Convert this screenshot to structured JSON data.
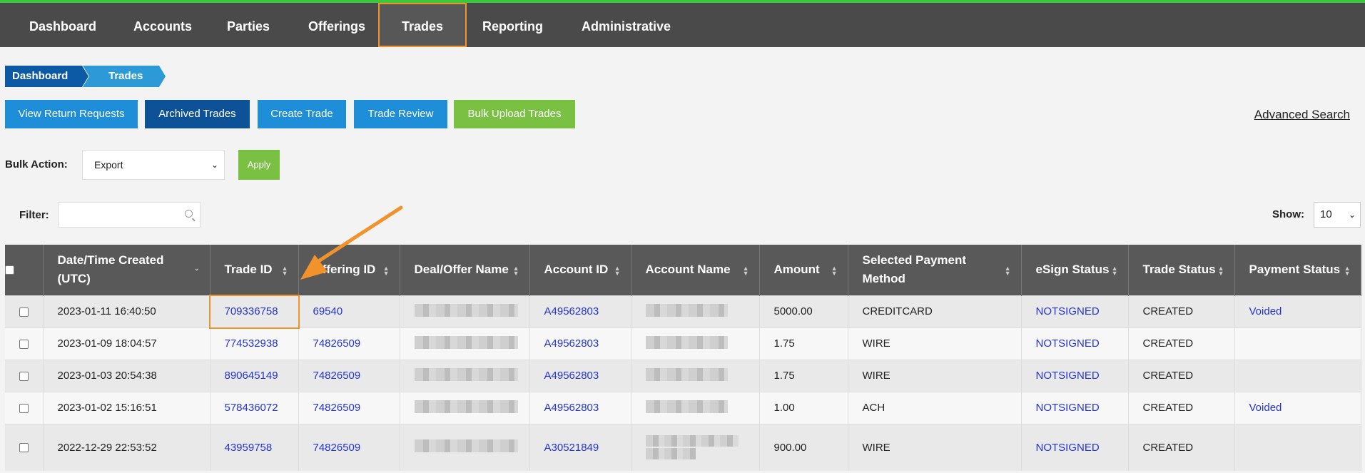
{
  "nav": [
    "Dashboard",
    "Accounts",
    "Parties",
    "Offerings",
    "Trades",
    "Reporting",
    "Administrative"
  ],
  "breadcrumb": [
    "Dashboard",
    "Trades"
  ],
  "buttons": [
    "View Return Requests",
    "Archived Trades",
    "Create Trade",
    "Trade Review",
    "Bulk Upload Trades"
  ],
  "advanced_search": "Advanced Search",
  "bulk": {
    "label": "Bulk Action:",
    "selected": "Export",
    "apply": "Apply"
  },
  "filter": {
    "label": "Filter:",
    "value": ""
  },
  "show": {
    "label": "Show:",
    "selected": "10"
  },
  "columns": [
    "Date/Time Created (UTC)",
    "Trade ID",
    "Offering ID",
    "Deal/Offer Name",
    "Account ID",
    "Account Name",
    "Amount",
    "Selected Payment Method",
    "eSign Status",
    "Trade Status",
    "Payment Status"
  ],
  "rows": [
    {
      "date": "2023-01-11 16:40:50",
      "trade_id": "709336758",
      "offering_id": "69540",
      "account_id": "A49562803",
      "amount": "5000.00",
      "payment_method": "CREDITCARD",
      "esign": "NOTSIGNED",
      "trade_status": "CREATED",
      "payment_status": "Voided"
    },
    {
      "date": "2023-01-09 18:04:57",
      "trade_id": "774532938",
      "offering_id": "74826509",
      "account_id": "A49562803",
      "amount": "1.75",
      "payment_method": "WIRE",
      "esign": "NOTSIGNED",
      "trade_status": "CREATED",
      "payment_status": ""
    },
    {
      "date": "2023-01-03 20:54:38",
      "trade_id": "890645149",
      "offering_id": "74826509",
      "account_id": "A49562803",
      "amount": "1.75",
      "payment_method": "WIRE",
      "esign": "NOTSIGNED",
      "trade_status": "CREATED",
      "payment_status": ""
    },
    {
      "date": "2023-01-02 15:16:51",
      "trade_id": "578436072",
      "offering_id": "74826509",
      "account_id": "A49562803",
      "amount": "1.00",
      "payment_method": "ACH",
      "esign": "NOTSIGNED",
      "trade_status": "CREATED",
      "payment_status": "Voided"
    },
    {
      "date": "2022-12-29 22:53:52",
      "trade_id": "43959758",
      "offering_id": "74826509",
      "account_id": "A30521849",
      "amount": "900.00",
      "payment_method": "WIRE",
      "esign": "NOTSIGNED",
      "trade_status": "CREATED",
      "payment_status": ""
    }
  ],
  "colors": {
    "highlight": "#f2922b",
    "nav_bg": "#4a4a4a",
    "link": "#2434d1",
    "accent_green": "#79c043"
  }
}
